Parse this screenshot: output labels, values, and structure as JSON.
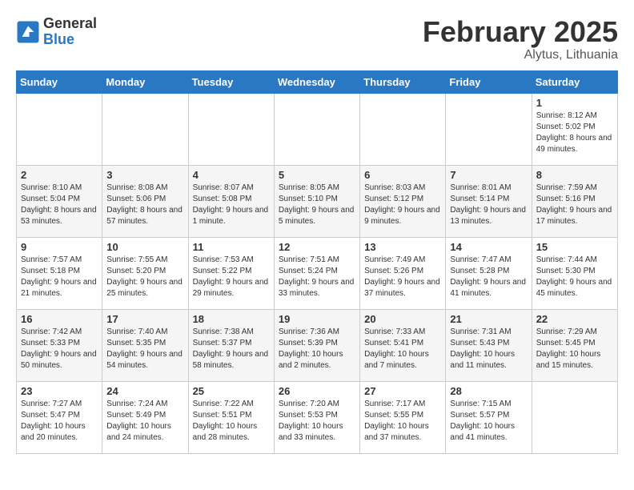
{
  "logo": {
    "general": "General",
    "blue": "Blue"
  },
  "title": "February 2025",
  "location": "Alytus, Lithuania",
  "days_header": [
    "Sunday",
    "Monday",
    "Tuesday",
    "Wednesday",
    "Thursday",
    "Friday",
    "Saturday"
  ],
  "weeks": [
    [
      {
        "day": "",
        "info": ""
      },
      {
        "day": "",
        "info": ""
      },
      {
        "day": "",
        "info": ""
      },
      {
        "day": "",
        "info": ""
      },
      {
        "day": "",
        "info": ""
      },
      {
        "day": "",
        "info": ""
      },
      {
        "day": "1",
        "info": "Sunrise: 8:12 AM\nSunset: 5:02 PM\nDaylight: 8 hours and 49 minutes."
      }
    ],
    [
      {
        "day": "2",
        "info": "Sunrise: 8:10 AM\nSunset: 5:04 PM\nDaylight: 8 hours and 53 minutes."
      },
      {
        "day": "3",
        "info": "Sunrise: 8:08 AM\nSunset: 5:06 PM\nDaylight: 8 hours and 57 minutes."
      },
      {
        "day": "4",
        "info": "Sunrise: 8:07 AM\nSunset: 5:08 PM\nDaylight: 9 hours and 1 minute."
      },
      {
        "day": "5",
        "info": "Sunrise: 8:05 AM\nSunset: 5:10 PM\nDaylight: 9 hours and 5 minutes."
      },
      {
        "day": "6",
        "info": "Sunrise: 8:03 AM\nSunset: 5:12 PM\nDaylight: 9 hours and 9 minutes."
      },
      {
        "day": "7",
        "info": "Sunrise: 8:01 AM\nSunset: 5:14 PM\nDaylight: 9 hours and 13 minutes."
      },
      {
        "day": "8",
        "info": "Sunrise: 7:59 AM\nSunset: 5:16 PM\nDaylight: 9 hours and 17 minutes."
      }
    ],
    [
      {
        "day": "9",
        "info": "Sunrise: 7:57 AM\nSunset: 5:18 PM\nDaylight: 9 hours and 21 minutes."
      },
      {
        "day": "10",
        "info": "Sunrise: 7:55 AM\nSunset: 5:20 PM\nDaylight: 9 hours and 25 minutes."
      },
      {
        "day": "11",
        "info": "Sunrise: 7:53 AM\nSunset: 5:22 PM\nDaylight: 9 hours and 29 minutes."
      },
      {
        "day": "12",
        "info": "Sunrise: 7:51 AM\nSunset: 5:24 PM\nDaylight: 9 hours and 33 minutes."
      },
      {
        "day": "13",
        "info": "Sunrise: 7:49 AM\nSunset: 5:26 PM\nDaylight: 9 hours and 37 minutes."
      },
      {
        "day": "14",
        "info": "Sunrise: 7:47 AM\nSunset: 5:28 PM\nDaylight: 9 hours and 41 minutes."
      },
      {
        "day": "15",
        "info": "Sunrise: 7:44 AM\nSunset: 5:30 PM\nDaylight: 9 hours and 45 minutes."
      }
    ],
    [
      {
        "day": "16",
        "info": "Sunrise: 7:42 AM\nSunset: 5:33 PM\nDaylight: 9 hours and 50 minutes."
      },
      {
        "day": "17",
        "info": "Sunrise: 7:40 AM\nSunset: 5:35 PM\nDaylight: 9 hours and 54 minutes."
      },
      {
        "day": "18",
        "info": "Sunrise: 7:38 AM\nSunset: 5:37 PM\nDaylight: 9 hours and 58 minutes."
      },
      {
        "day": "19",
        "info": "Sunrise: 7:36 AM\nSunset: 5:39 PM\nDaylight: 10 hours and 2 minutes."
      },
      {
        "day": "20",
        "info": "Sunrise: 7:33 AM\nSunset: 5:41 PM\nDaylight: 10 hours and 7 minutes."
      },
      {
        "day": "21",
        "info": "Sunrise: 7:31 AM\nSunset: 5:43 PM\nDaylight: 10 hours and 11 minutes."
      },
      {
        "day": "22",
        "info": "Sunrise: 7:29 AM\nSunset: 5:45 PM\nDaylight: 10 hours and 15 minutes."
      }
    ],
    [
      {
        "day": "23",
        "info": "Sunrise: 7:27 AM\nSunset: 5:47 PM\nDaylight: 10 hours and 20 minutes."
      },
      {
        "day": "24",
        "info": "Sunrise: 7:24 AM\nSunset: 5:49 PM\nDaylight: 10 hours and 24 minutes."
      },
      {
        "day": "25",
        "info": "Sunrise: 7:22 AM\nSunset: 5:51 PM\nDaylight: 10 hours and 28 minutes."
      },
      {
        "day": "26",
        "info": "Sunrise: 7:20 AM\nSunset: 5:53 PM\nDaylight: 10 hours and 33 minutes."
      },
      {
        "day": "27",
        "info": "Sunrise: 7:17 AM\nSunset: 5:55 PM\nDaylight: 10 hours and 37 minutes."
      },
      {
        "day": "28",
        "info": "Sunrise: 7:15 AM\nSunset: 5:57 PM\nDaylight: 10 hours and 41 minutes."
      },
      {
        "day": "",
        "info": ""
      }
    ]
  ]
}
